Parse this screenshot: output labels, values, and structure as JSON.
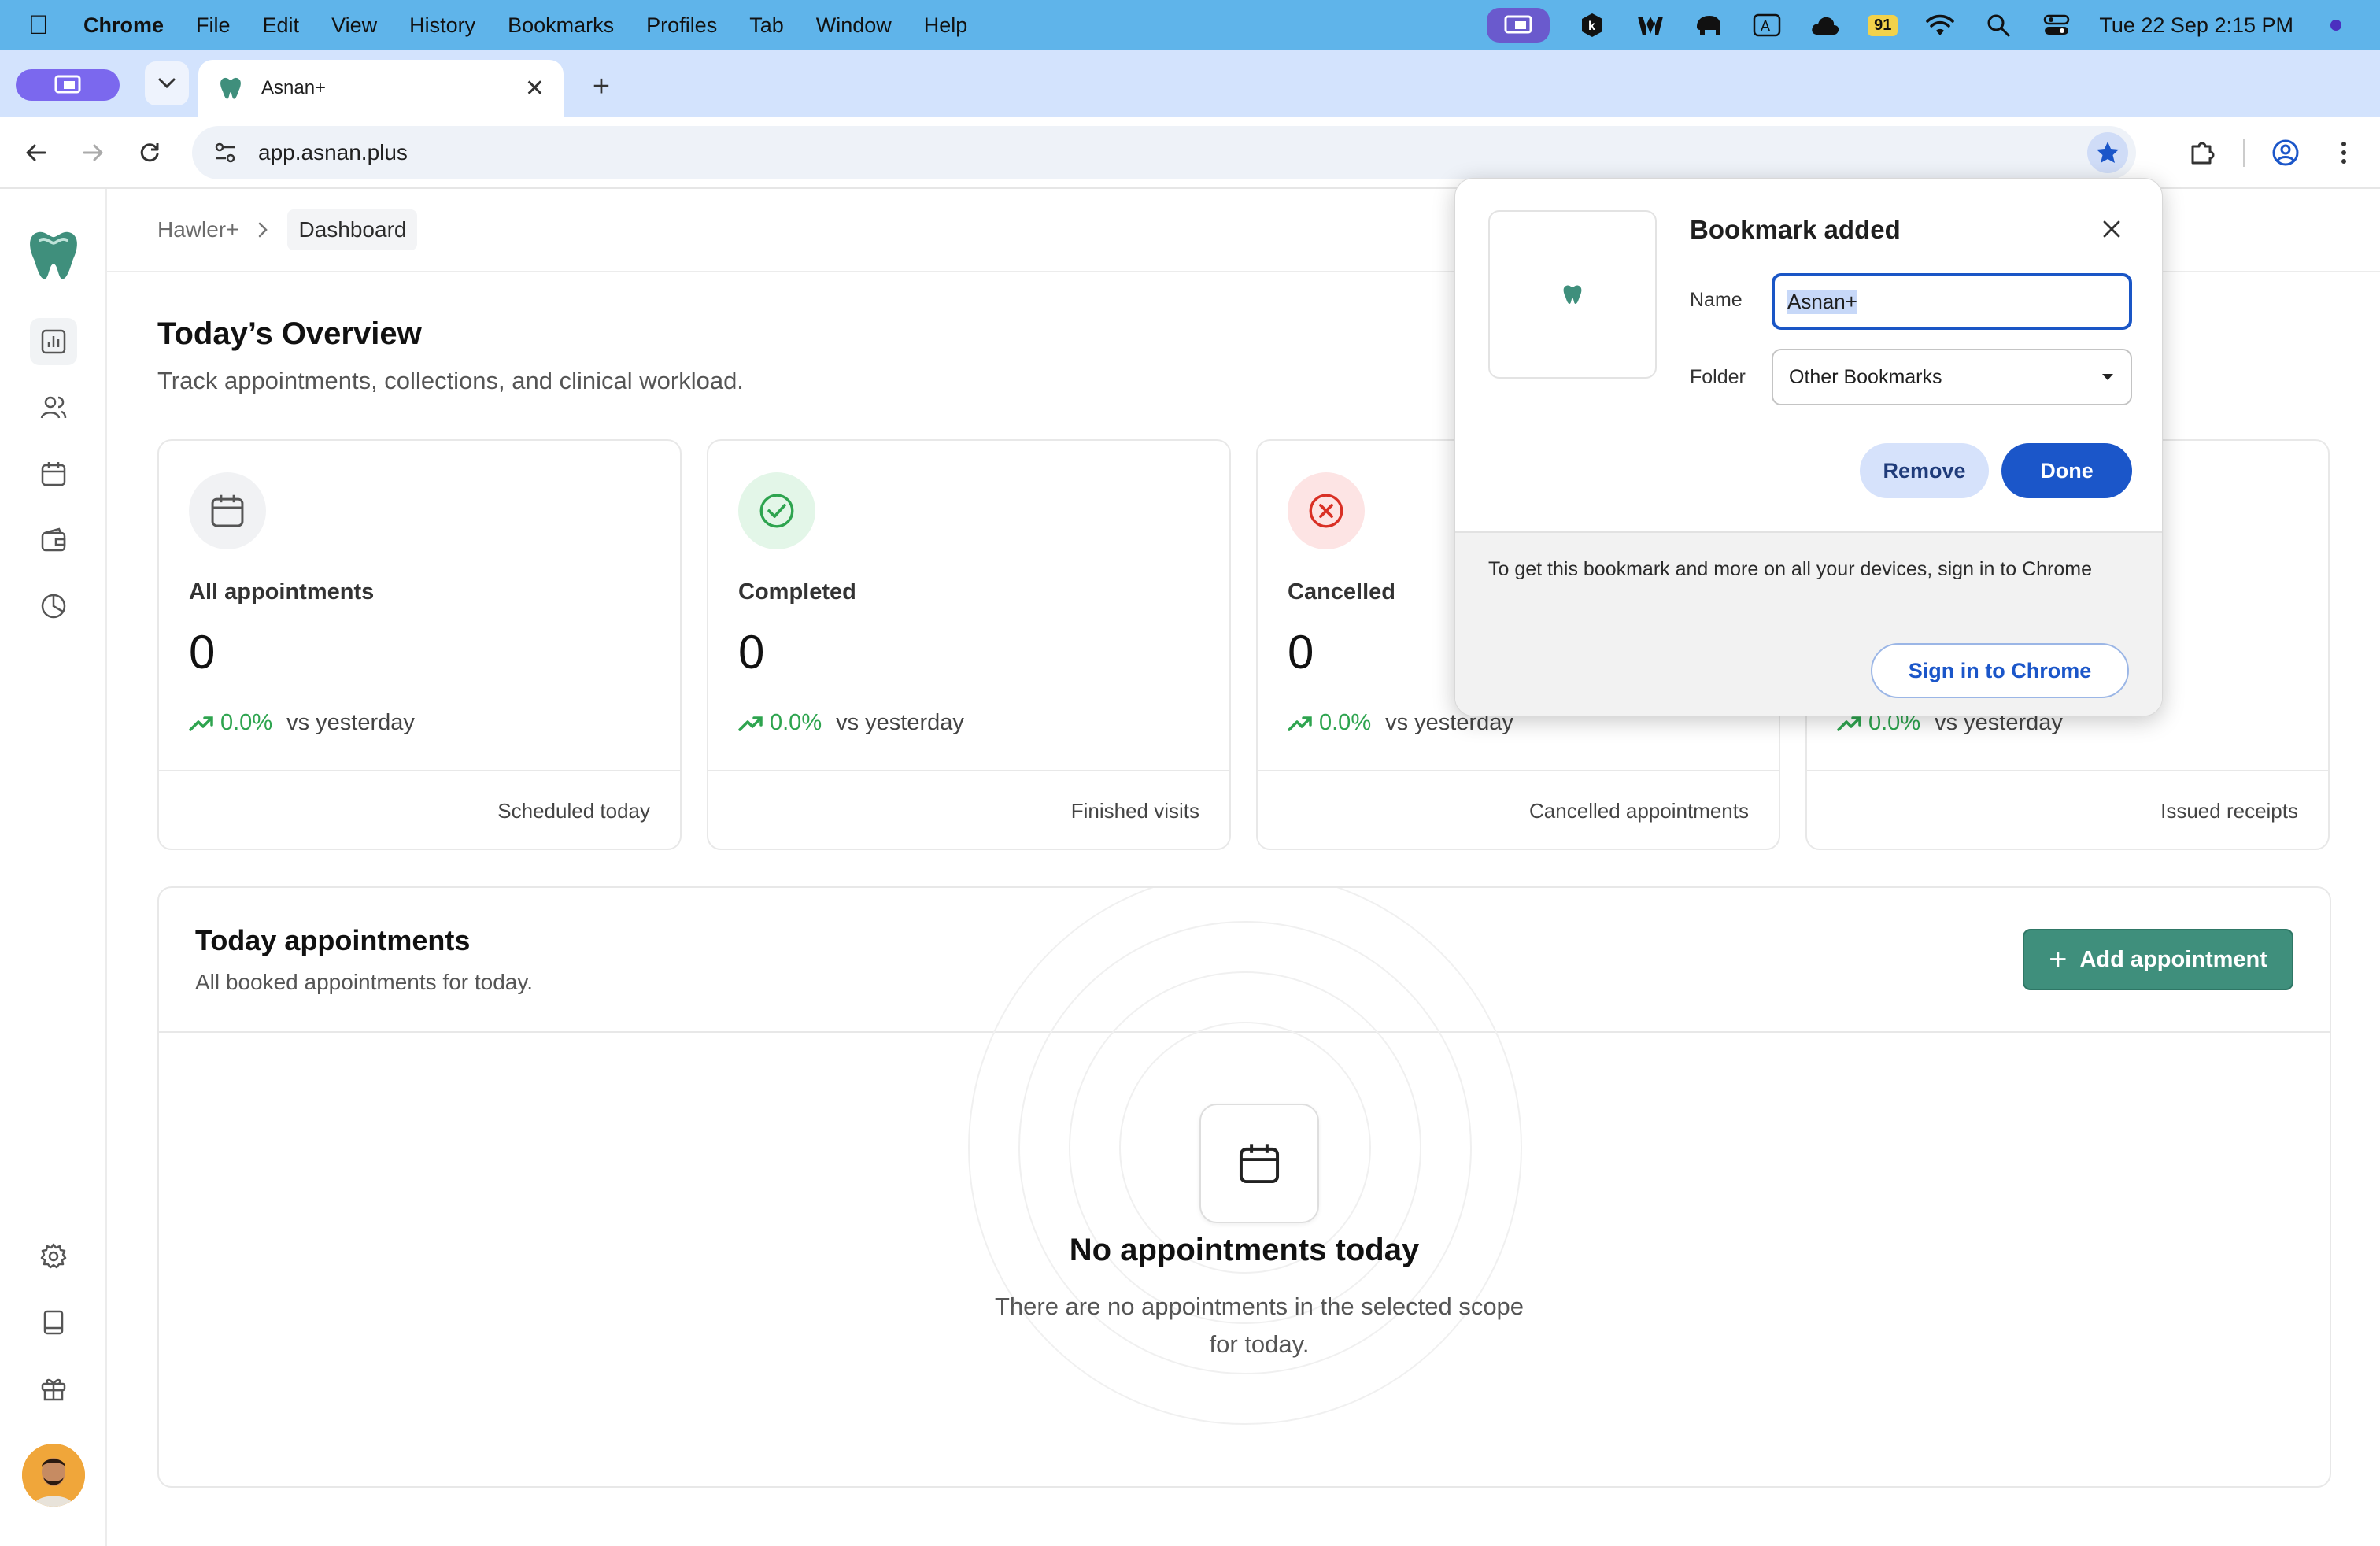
{
  "menubar": {
    "app_name": "Chrome",
    "items": [
      "File",
      "Edit",
      "View",
      "History",
      "Bookmarks",
      "Profiles",
      "Tab",
      "Window",
      "Help"
    ],
    "battery": "91",
    "clock": "Tue 22 Sep  2:15 PM"
  },
  "browser": {
    "tab_title": "Asnan+",
    "url": "app.asnan.plus"
  },
  "breadcrumb": {
    "parent": "Hawler+",
    "current": "Dashboard"
  },
  "overview": {
    "title": "Today’s Overview",
    "subtitle": "Track appointments, collections, and clinical workload.",
    "cards": [
      {
        "label": "All appointments",
        "value": "0",
        "trend_pct": "0.0%",
        "trend_vs": "vs yesterday",
        "footer": "Scheduled today",
        "icon": "calendar-icon",
        "icon_bg": "#f1f2f4",
        "icon_color": "#555555"
      },
      {
        "label": "Completed",
        "value": "0",
        "trend_pct": "0.0%",
        "trend_vs": "vs yesterday",
        "footer": "Finished visits",
        "icon": "check-circle-icon",
        "icon_bg": "#e3f6e8",
        "icon_color": "#2ea44f"
      },
      {
        "label": "Cancelled",
        "value": "0",
        "trend_pct": "0.0%",
        "trend_vs": "vs yesterday",
        "footer": "Cancelled appointments",
        "icon": "x-circle-icon",
        "icon_bg": "#fde4e4",
        "icon_color": "#d93025"
      },
      {
        "label": "",
        "value": "",
        "trend_pct": "0.0%",
        "trend_vs": "vs yesterday",
        "footer": "Issued receipts",
        "icon": "",
        "icon_bg": "#ffffff",
        "icon_color": "#555555"
      }
    ]
  },
  "appointments": {
    "title": "Today appointments",
    "subtitle": "All booked appointments for today.",
    "add_label": "Add appointment",
    "empty_title": "No appointments today",
    "empty_desc": "There are no appointments in the selected scope for today."
  },
  "bookmark_popup": {
    "title": "Bookmark added",
    "name_label": "Name",
    "name_value": "Asnan+",
    "folder_label": "Folder",
    "folder_value": "Other Bookmarks",
    "remove_label": "Remove",
    "done_label": "Done",
    "signin_text": "To get this bookmark and more on all your devices, sign in to Chrome",
    "signin_button": "Sign in to Chrome"
  },
  "colors": {
    "accent": "#3f8f7c",
    "chrome_blue": "#1b56c9",
    "trend_green": "#2ea44f"
  }
}
